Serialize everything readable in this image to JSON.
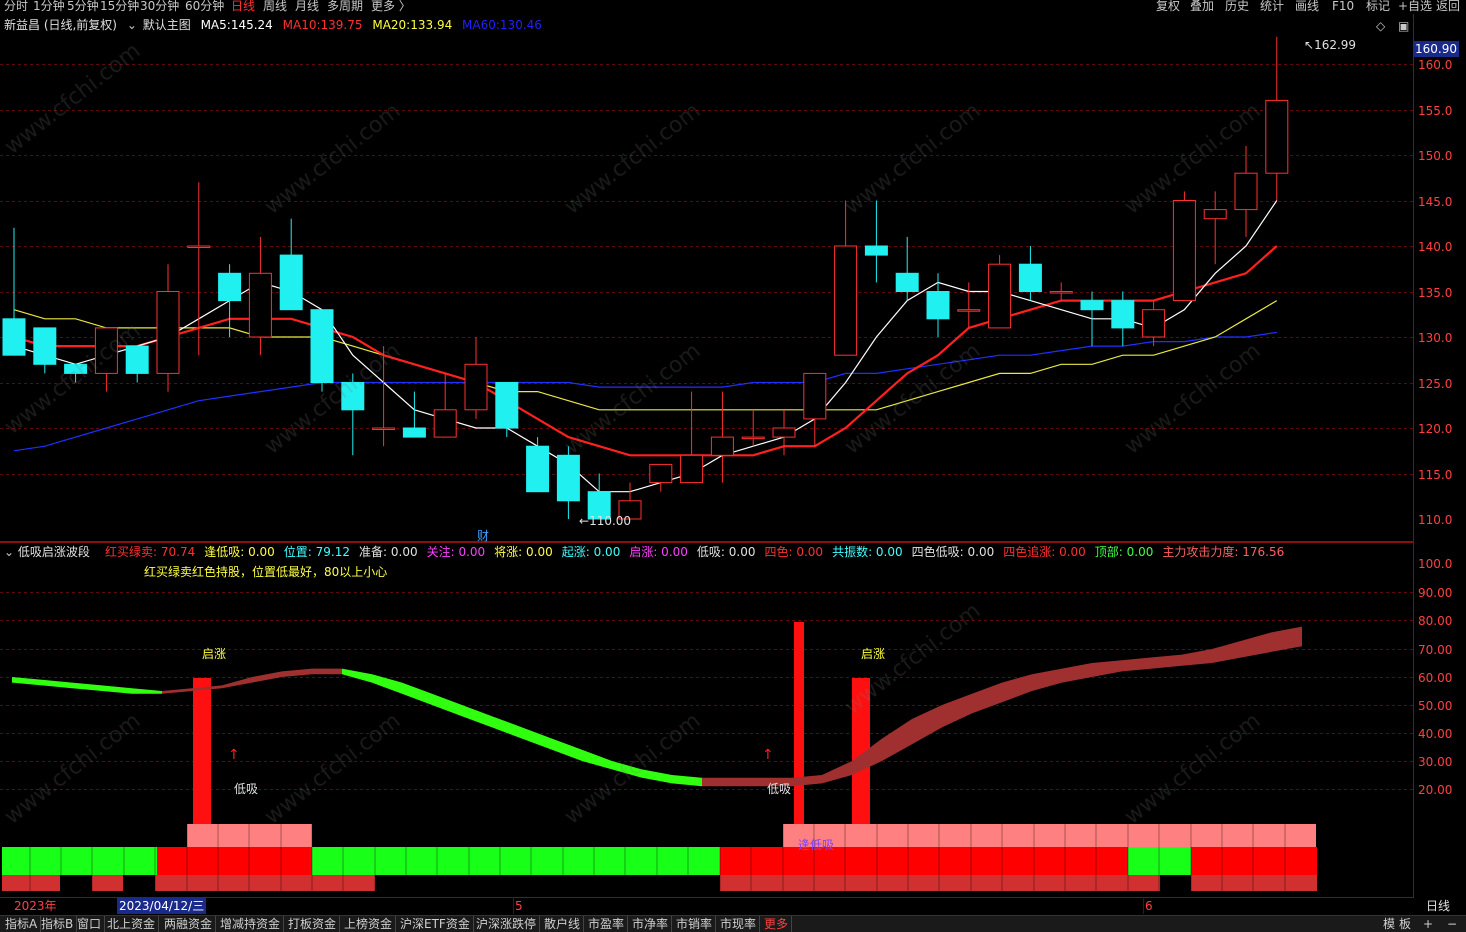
{
  "topbar": {
    "periods": [
      "分时",
      "1分钟",
      "5分钟",
      "15分钟",
      "30分钟",
      "60分钟",
      "日线",
      "周线",
      "月线",
      "多周期",
      "更多 〉"
    ],
    "active_period": "日线",
    "actions": [
      "复权",
      "叠加",
      "历史",
      "统计",
      "画线",
      "F10",
      "标记",
      "+自选",
      "返回"
    ]
  },
  "main_chart": {
    "stock_title": "新益昌 (日线,前复权)",
    "template_label": "默认主图",
    "ma": [
      {
        "label": "MA5:",
        "value": "145.24",
        "color": "#ffffff"
      },
      {
        "label": "MA10:",
        "value": "139.75",
        "color": "#ff3030"
      },
      {
        "label": "MA20:",
        "value": "133.94",
        "color": "#ffff40"
      },
      {
        "label": "MA60:",
        "value": "130.46",
        "color": "#2020ff"
      }
    ],
    "current_price": "160.90",
    "high_label": "162.99",
    "low_label": "110.00",
    "fin_marker": "财",
    "ticks": [
      "160.0",
      "155.0",
      "150.0",
      "145.0",
      "140.0",
      "135.0",
      "130.0",
      "125.0",
      "120.0",
      "115.0",
      "110.0"
    ]
  },
  "sub_chart": {
    "indicator_name": "低吸启涨波段",
    "values": [
      {
        "label": "红买绿卖:",
        "value": "70.74",
        "color": "#ff3030"
      },
      {
        "label": "逢低吸:",
        "value": "0.00",
        "color": "#ffff40"
      },
      {
        "label": "位置:",
        "value": "79.12",
        "color": "#40ffff"
      },
      {
        "label": "准备:",
        "value": "0.00",
        "color": "#e0e0e0"
      },
      {
        "label": "关注:",
        "value": "0.00",
        "color": "#ff40ff"
      },
      {
        "label": "将涨:",
        "value": "0.00",
        "color": "#ffff40"
      },
      {
        "label": "起涨:",
        "value": "0.00",
        "color": "#40ffff"
      },
      {
        "label": "启涨:",
        "value": "0.00",
        "color": "#ff40ff"
      },
      {
        "label": "低吸:",
        "value": "0.00",
        "color": "#e0e0e0"
      },
      {
        "label": "四色:",
        "value": "0.00",
        "color": "#ff3030"
      },
      {
        "label": "共振数:",
        "value": "0.00",
        "color": "#40ffff"
      },
      {
        "label": "四色低吸:",
        "value": "0.00",
        "color": "#e0e0e0"
      },
      {
        "label": "四色追涨:",
        "value": "0.00",
        "color": "#ff3030"
      },
      {
        "label": "顶部:",
        "value": "0.00",
        "color": "#40ff40"
      },
      {
        "label": "主力攻击力度:",
        "value": "176.56",
        "color": "#ff6060"
      }
    ],
    "note": "红买绿卖红色持股，位置低最好，80以上小心",
    "ticks": [
      "100.0",
      "90.00",
      "80.00",
      "70.00",
      "60.00",
      "50.00",
      "40.00",
      "30.00",
      "20.00"
    ],
    "signals": {
      "qizhang": "启涨",
      "dixi": "低吸",
      "fengdixi": "逢低吸"
    }
  },
  "date_axis": {
    "year": "2023年",
    "cursor_date": "2023/04/12/三",
    "month5": "5",
    "month6": "6",
    "period": "日线"
  },
  "bottombar": {
    "tabs": [
      "指标A",
      "指标B",
      "窗口",
      "北上资金",
      "两融资金",
      "增减持资金",
      "打板资金",
      "上榜资金",
      "沪深ETF资金",
      "沪深涨跌停",
      "散户线",
      "市盈率",
      "市净率",
      "市销率",
      "市现率",
      "更多"
    ],
    "right": [
      "模",
      "板",
      "+",
      "−"
    ]
  },
  "watermark": "www.cfchi.com",
  "chart_data": {
    "type": "candlestick",
    "candles": [
      [
        132,
        128,
        142,
        128
      ],
      [
        131,
        127,
        131,
        126
      ],
      [
        127,
        126,
        127,
        125
      ],
      [
        126,
        131,
        131,
        124
      ],
      [
        129,
        126,
        129,
        125
      ],
      [
        126,
        135,
        138,
        124
      ],
      [
        140,
        140,
        147,
        128
      ],
      [
        137,
        134,
        138,
        130
      ],
      [
        130,
        137,
        141,
        128
      ],
      [
        139,
        133,
        143,
        133
      ],
      [
        133,
        125,
        133,
        124
      ],
      [
        125,
        122,
        126,
        117
      ],
      [
        120,
        120,
        129,
        118
      ],
      [
        120,
        119,
        124,
        119
      ],
      [
        119,
        122,
        126,
        119
      ],
      [
        122,
        127,
        130,
        121
      ],
      [
        125,
        120,
        125,
        119
      ],
      [
        118,
        113,
        119,
        113
      ],
      [
        117,
        112,
        118,
        110
      ],
      [
        113,
        110,
        115,
        110
      ],
      [
        110,
        112,
        114,
        111
      ],
      [
        114,
        116,
        115,
        113
      ],
      [
        114,
        117,
        124,
        114
      ],
      [
        117,
        119,
        124,
        114
      ],
      [
        119,
        119,
        122,
        118
      ],
      [
        119,
        120,
        122,
        117
      ],
      [
        121,
        126,
        126,
        118
      ],
      [
        128,
        140,
        145,
        128
      ],
      [
        140,
        139,
        145,
        136
      ],
      [
        137,
        135,
        141,
        134
      ],
      [
        135,
        132,
        137,
        130
      ],
      [
        133,
        133,
        136,
        131
      ],
      [
        131,
        138,
        139,
        131
      ],
      [
        138,
        135,
        140,
        134
      ],
      [
        135,
        135,
        136,
        134
      ],
      [
        134,
        133,
        135,
        129
      ],
      [
        134,
        131,
        135,
        129
      ],
      [
        130,
        133,
        134,
        129
      ],
      [
        134,
        145,
        146,
        134
      ],
      [
        143,
        144,
        146,
        138
      ],
      [
        144,
        148,
        151,
        141
      ],
      [
        148,
        156,
        163,
        145
      ]
    ],
    "ma5": [
      129,
      128,
      127,
      128,
      129,
      130,
      132,
      134,
      136,
      135,
      133,
      128,
      125,
      122,
      121,
      120,
      120,
      118,
      116,
      113,
      113,
      114,
      115,
      117,
      118,
      119,
      121,
      125,
      130,
      134,
      136,
      135,
      135,
      134,
      133,
      132,
      132,
      131,
      133,
      137,
      140,
      145
    ],
    "ma10": [
      130,
      129,
      129,
      129,
      129,
      130,
      131,
      132,
      132,
      132,
      131,
      130,
      128,
      127,
      126,
      125,
      123,
      121,
      119,
      118,
      117,
      117,
      117,
      117,
      117,
      118,
      118,
      120,
      123,
      126,
      128,
      131,
      132,
      133,
      134,
      134,
      134,
      134,
      135,
      136,
      137,
      140
    ],
    "ma20": [
      133,
      132,
      132,
      131,
      131,
      131,
      131,
      131,
      130,
      130,
      130,
      129,
      128,
      127,
      126,
      125,
      124,
      124,
      123,
      122,
      122,
      122,
      122,
      122,
      122,
      122,
      122,
      122,
      122,
      123,
      124,
      125,
      126,
      126,
      127,
      127,
      128,
      128,
      129,
      130,
      132,
      134
    ],
    "ma60": [
      117.5,
      118,
      119,
      120,
      121,
      122,
      123,
      123.5,
      124,
      124.5,
      125,
      125,
      125,
      125,
      125,
      125,
      125,
      125,
      125,
      124.5,
      124.5,
      124.5,
      124.5,
      124.5,
      125,
      125,
      125,
      126,
      126,
      126.5,
      127,
      127.5,
      128,
      128,
      128.5,
      129,
      129,
      129.5,
      129.5,
      130,
      130,
      130.5
    ],
    "wave_top": [
      60,
      59,
      58,
      57,
      56,
      55,
      56,
      57,
      60,
      62,
      63,
      63,
      61,
      58,
      54,
      50,
      46,
      42,
      38,
      34,
      30,
      27,
      25,
      24,
      24,
      24,
      24,
      25,
      30,
      38,
      45,
      50,
      54,
      58,
      61,
      63,
      65,
      66,
      67,
      68,
      70,
      73,
      76,
      78
    ],
    "wave_bottom": [
      58,
      57,
      56,
      55,
      54,
      54,
      55,
      56,
      58,
      60,
      61,
      61,
      58,
      54,
      50,
      46,
      42,
      38,
      34,
      30,
      27,
      24,
      22,
      21,
      21,
      21,
      21,
      22,
      25,
      30,
      36,
      42,
      47,
      51,
      55,
      58,
      60,
      62,
      63,
      64,
      65,
      67,
      69,
      71
    ],
    "ylim_main": [
      108,
      165
    ],
    "ylim_sub": [
      0,
      105
    ]
  }
}
